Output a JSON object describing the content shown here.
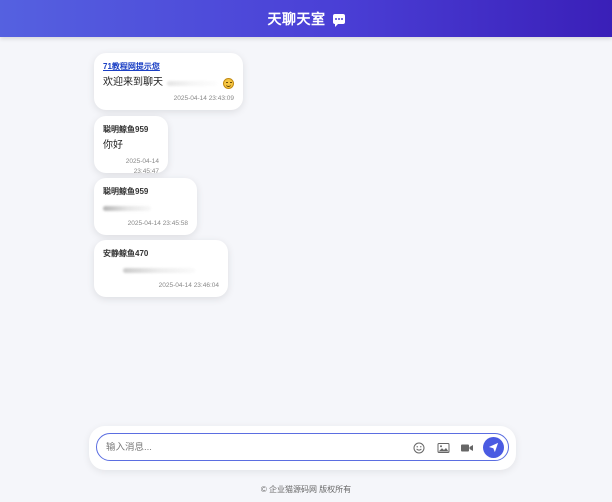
{
  "header": {
    "title": "天聊天室",
    "icon": "chat-bubble-icon"
  },
  "messages": [
    {
      "sender": "71教程网提示您",
      "text": "欢迎来到聊天",
      "time": "2025-04-14 23:43:09",
      "has_emoji": true
    },
    {
      "sender": "聪明鲸鱼959",
      "text": "你好",
      "time": "2025-04-14 23:45:47"
    },
    {
      "sender": "聪明鲸鱼959",
      "text": "",
      "time": "2025-04-14 23:45:58"
    },
    {
      "sender": "安静鲸鱼470",
      "text": "",
      "time": "2025-04-14 23:46:04"
    }
  ],
  "composer": {
    "placeholder": "输入消息...",
    "value": "",
    "tools": [
      "emoji-icon",
      "image-icon",
      "video-icon"
    ],
    "send_icon": "send-icon"
  },
  "footer": {
    "text": "© 企业猫源码网 版权所有"
  },
  "colors": {
    "header_start": "#5561e0",
    "header_end": "#3a1fb8",
    "accent": "#4a5be2",
    "background": "#f5f6fa"
  }
}
